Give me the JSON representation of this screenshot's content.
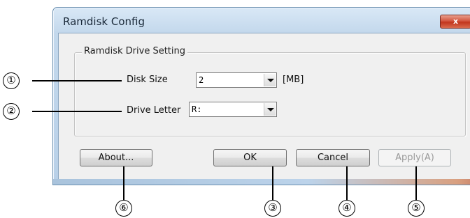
{
  "window": {
    "title": "Ramdisk Config",
    "close_glyph": "x"
  },
  "group": {
    "legend": "Ramdisk Drive Setting"
  },
  "fields": {
    "disk_size": {
      "label": "Disk Size",
      "value": "2",
      "unit": "[MB]"
    },
    "drive_letter": {
      "label": "Drive Letter",
      "value": "R:"
    }
  },
  "buttons": {
    "about": "About...",
    "ok": "OK",
    "cancel": "Cancel",
    "apply": "Apply(A)"
  },
  "callouts": [
    "①",
    "②",
    "③",
    "④",
    "⑤",
    "⑥"
  ]
}
